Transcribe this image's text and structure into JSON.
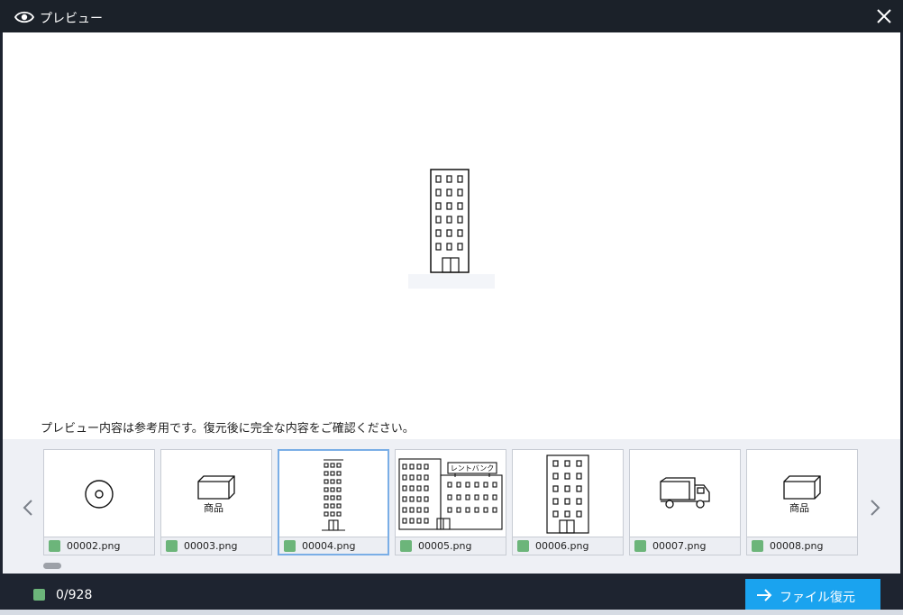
{
  "window": {
    "title": "プレビュー",
    "title_icon": "eye-icon",
    "close_icon": "close-icon"
  },
  "preview": {
    "image_subject": "building",
    "notice": "プレビュー内容は参考用です。復元後に完全な内容をご確認ください。"
  },
  "thumbnails": [
    {
      "name": "00002.png",
      "icon": "disc",
      "checked": true,
      "selected": false
    },
    {
      "name": "00003.png",
      "icon": "goods-box",
      "label": "商品",
      "checked": true,
      "selected": false
    },
    {
      "name": "00004.png",
      "icon": "tower-building",
      "checked": true,
      "selected": true
    },
    {
      "name": "00005.png",
      "icon": "shopping-complex",
      "label": "レントバンク",
      "checked": true,
      "selected": false
    },
    {
      "name": "00006.png",
      "icon": "building",
      "checked": true,
      "selected": false
    },
    {
      "name": "00007.png",
      "icon": "truck",
      "checked": true,
      "selected": false
    },
    {
      "name": "00008.png",
      "icon": "goods-box",
      "label": "商品",
      "checked": true,
      "selected": false
    }
  ],
  "navigation": {
    "prev_icon": "chevron-left-icon",
    "next_icon": "chevron-right-icon"
  },
  "footer": {
    "count": "0/928",
    "recover_label": "ファイル復元",
    "recover_icon": "arrow-right-icon"
  },
  "colors": {
    "titlebar": "#1b2129",
    "footer": "#1e2430",
    "check": "#6cb57a",
    "primary_button": "#1aa3ef",
    "selected_border": "#7aaee6"
  }
}
